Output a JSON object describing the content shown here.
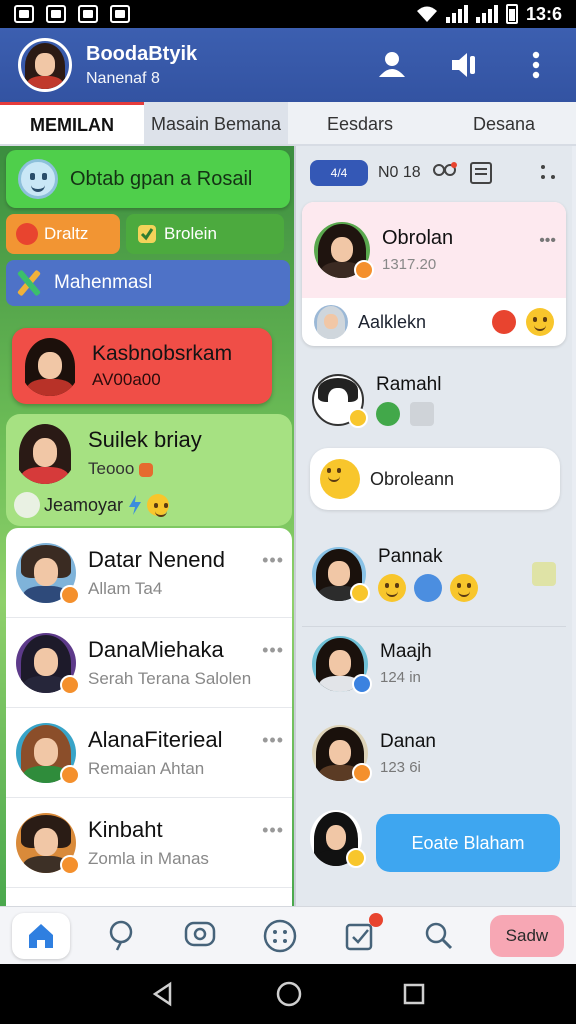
{
  "status_bar": {
    "time": "13:6"
  },
  "header": {
    "title": "BoodaBtyik",
    "subtitle": "Nanenaf 8"
  },
  "tabs": [
    {
      "label": "MEMILAN"
    },
    {
      "label": "Masain Bemana"
    },
    {
      "label": "Eesdars"
    },
    {
      "label": "Desana"
    }
  ],
  "left": {
    "green_card": "Obtab gpan a Rosail",
    "pill_orange": "Draltz",
    "pill_green": "Brolein",
    "blue_strip": "Mahenmasl",
    "red_card": {
      "name": "Kasbnobsrkam",
      "sub": "AV00a00"
    },
    "green_card2": {
      "name": "Suilek briay",
      "sub": "Teooo",
      "row": "Jeamoyar"
    },
    "list": [
      {
        "name": "Datar Nenend",
        "sub": "Allam Ta4"
      },
      {
        "name": "DanaMiehaka",
        "sub": "Serah Terana Salolen"
      },
      {
        "name": "AlanaFiterieal",
        "sub": "Remaian Ahtan"
      },
      {
        "name": "Kinbaht",
        "sub": "Zomla in Manas"
      }
    ]
  },
  "right": {
    "top_pill": "4/4",
    "top_num": "N0 18",
    "card1": {
      "name": "Obrolan",
      "sub": "1317.20",
      "bottom": "Aalklekn"
    },
    "item_ramahl": {
      "name": "Ramahl"
    },
    "bubble": "Obroleann",
    "items": [
      {
        "name": "Pannak",
        "sub": ""
      },
      {
        "name": "Maajh",
        "sub": "124 in"
      },
      {
        "name": "Danan",
        "sub": "123 6i"
      }
    ],
    "cta_button": "Eoate Blaham"
  },
  "bottom_nav": {
    "last_button": "Sadw"
  },
  "colors": {
    "header": "#3c5fb0",
    "accent_red": "#e53b3b",
    "green": "#4fcf4b",
    "blue_button": "#3ea6f0"
  }
}
